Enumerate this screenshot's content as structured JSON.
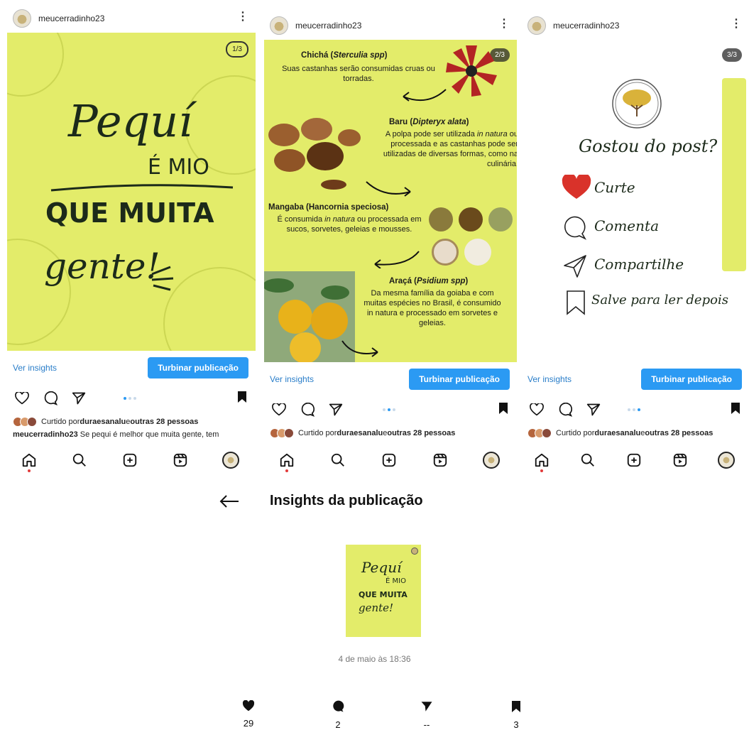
{
  "account": {
    "username": "meucerradinho23"
  },
  "posts": [
    {
      "badge": "1/3",
      "slide1": {
        "line1": "Pequí",
        "line2": "É MIO",
        "line3": "QUE MUITA",
        "line4": "gente!"
      }
    },
    {
      "badge": "2/3",
      "fruits": [
        {
          "name": "Chichá (",
          "sci": "Sterculia spp",
          "close": ")",
          "desc": "Suas castanhas serão consumidas cruas ou torradas."
        },
        {
          "name": "Baru (",
          "sci": "Dipteryx alata",
          "close": ")",
          "desc1": "A polpa pode ser utilizada ",
          "desc_i": "in natura",
          "desc2": " ou processada e as castanhas pode ser utilizadas de diversas formas, como na culinária."
        },
        {
          "name": "Mangaba (Hancornia speciosa)",
          "desc1": "É consumida ",
          "desc_i": "in natura",
          "desc2": " ou processada em sucos, sorvetes, geleias e mousses."
        },
        {
          "name": "Araçá (",
          "sci": "Psidium spp",
          "close": ")",
          "desc": "Da mesma família da goiaba e com muitas espécies no Brasil, é consumido in natura e processado em sorvetes e geleias."
        }
      ]
    },
    {
      "badge": "3/3",
      "cta": {
        "title": "Gostou do post?",
        "like": "Curte",
        "comment": "Comenta",
        "share": "Compartilhe",
        "save": "Salve para ler depois"
      }
    }
  ],
  "post_ui": {
    "insights_link": "Ver insights",
    "boost_button": "Turbinar publicação",
    "liked_prefix": "Curtido por ",
    "liked_user": "duraesanalu",
    "liked_mid": " e ",
    "liked_others": "outras 28 pessoas",
    "caption_user": "meucerradinho23",
    "caption_text": " Se pequi é melhor que muita gente, tem"
  },
  "insights": {
    "title": "Insights da publicação",
    "date": "4 de maio às 18:36",
    "stats": {
      "likes": "29",
      "comments": "2",
      "shares": "--",
      "saves": "3"
    }
  },
  "colors": {
    "post_bg": "#e3ec6a",
    "accent_blue": "#2b9af3",
    "link_blue": "#2a7ec9",
    "heart_red": "#d9322a"
  }
}
